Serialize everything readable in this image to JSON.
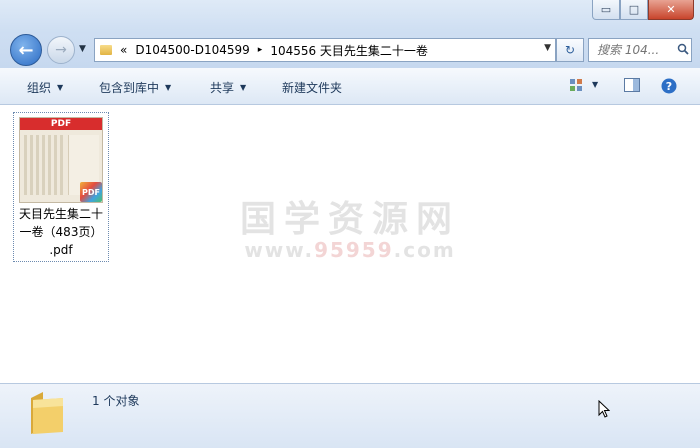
{
  "window": {
    "minimize": "▭",
    "maximize": "□",
    "close": "✕"
  },
  "nav": {
    "back_glyph": "←",
    "forward_glyph": "→",
    "dropdown_glyph": "▼"
  },
  "address": {
    "overflow": "«",
    "crumbs": [
      "D104500-D104599",
      "104556 天目先生集二十一卷"
    ],
    "separator": "▸",
    "dropdown_glyph": "▼"
  },
  "refresh_glyph": "↻",
  "search": {
    "placeholder": "搜索 104...",
    "icon": "search-icon"
  },
  "toolbar": {
    "organize": "组织",
    "include_library": "包含到库中",
    "share": "共享",
    "new_folder": "新建文件夹",
    "arrow": "▼"
  },
  "file": {
    "name_line1": "天目先生集二十",
    "name_line2": "一卷（483页）",
    "name_line3": ".pdf",
    "thumb_header": "PDF",
    "badge": "PDF"
  },
  "watermark": {
    "text": "国学资源网",
    "url_left": "www.",
    "url_mid": "95959",
    "url_right": ".com"
  },
  "status": {
    "count_text": "1 个对象"
  }
}
